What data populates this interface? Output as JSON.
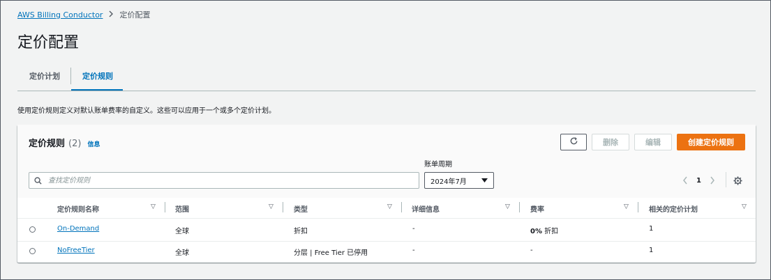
{
  "breadcrumb": {
    "items": [
      "AWS Billing Conductor",
      "定价配置"
    ],
    "separator": ">"
  },
  "page": {
    "title": "定价配置",
    "description": "使用定价规则定义对默认账单费率的自定义。这些可以应用于一个或多个定价计划。"
  },
  "tabs": [
    {
      "label": "定价计划",
      "active": false
    },
    {
      "label": "定价规则",
      "active": true
    }
  ],
  "panel": {
    "title": "定价规则",
    "count": "(2)",
    "info": "信息",
    "buttons": {
      "refresh_icon": "refresh-icon",
      "delete": "删除",
      "edit": "编辑",
      "create": "创建定价规则"
    },
    "search": {
      "placeholder": "查找定价规则"
    },
    "billing_period": {
      "label": "账单周期",
      "value": "2024年7月"
    },
    "pagination": {
      "current": "1"
    },
    "columns": [
      "定价规则名称",
      "范围",
      "类型",
      "详细信息",
      "费率",
      "相关的定价计划"
    ],
    "rows": [
      {
        "name": "On-Demand",
        "scope": "全球",
        "type": "折扣",
        "details": "-",
        "rate_bold": "0%",
        "rate_rest": "折扣",
        "plans": "1"
      },
      {
        "name": "NoFreeTier",
        "scope": "全球",
        "type": "分层 | Free Tier 已停用",
        "details": "-",
        "rate_bold": "",
        "rate_rest": "-",
        "plans": "1"
      }
    ]
  },
  "colors": {
    "accent": "#0073bb",
    "primary_button": "#ec7211",
    "background": "#f2f3f3"
  }
}
